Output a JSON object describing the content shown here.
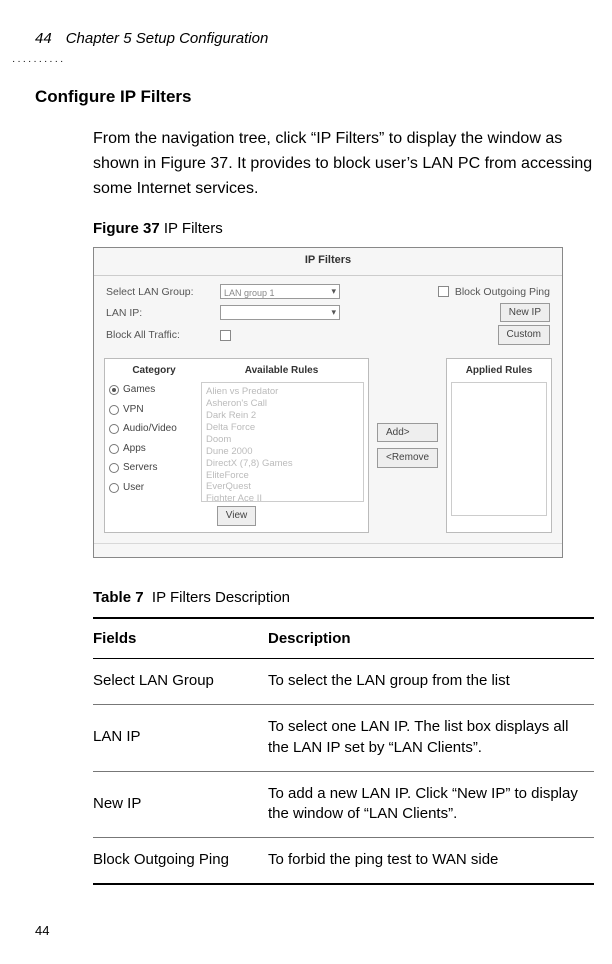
{
  "header": {
    "page_num": "44",
    "chapter": "Chapter 5 Setup Configuration"
  },
  "section_title": "Configure IP Filters",
  "body_paragraph": "From the navigation tree, click “IP Filters” to display the window as shown in Figure 37. It provides to block user’s LAN PC from accessing some Internet services.",
  "figure": {
    "label": "Figure 37",
    "title": "IP Filters",
    "panel_title": "IP Filters",
    "labels": {
      "select_lan_group": "Select LAN Group:",
      "lan_group_value": "LAN group 1",
      "lan_ip": "LAN IP:",
      "block_all_traffic": "Block All Traffic:",
      "block_outgoing_ping": "Block Outgoing Ping",
      "new_ip_btn": "New IP",
      "custom_btn": "Custom",
      "add_btn": "Add>",
      "remove_btn": "<Remove",
      "view_btn": "View",
      "category": "Category",
      "available_rules": "Available Rules",
      "applied_rules": "Applied Rules"
    },
    "categories": [
      "Games",
      "VPN",
      "Audio/Video",
      "Apps",
      "Servers",
      "User"
    ],
    "available_list": [
      "Alien vs Predator",
      "Asheron's Call",
      "Dark Rein 2",
      "Delta Force",
      "Doom",
      "Dune 2000",
      "DirectX (7,8) Games",
      "EliteForce",
      "EverQuest",
      "Fighter Ace II"
    ]
  },
  "table": {
    "label": "Table 7",
    "title": "IP Filters Description",
    "headers": {
      "fields": "Fields",
      "description": "Description"
    },
    "rows": [
      {
        "field": "Select LAN Group",
        "desc": "To select the LAN group from the list"
      },
      {
        "field": "LAN IP",
        "desc": "To select one LAN IP. The list box displays all the LAN IP set by “LAN Clients”."
      },
      {
        "field": "New IP",
        "desc": "To add a new LAN IP. Click “New IP” to display the window of “LAN Clients”."
      },
      {
        "field": "Block Outgoing Ping",
        "desc": "To forbid the ping test to WAN side"
      }
    ]
  },
  "footer": {
    "page_num": "44"
  }
}
